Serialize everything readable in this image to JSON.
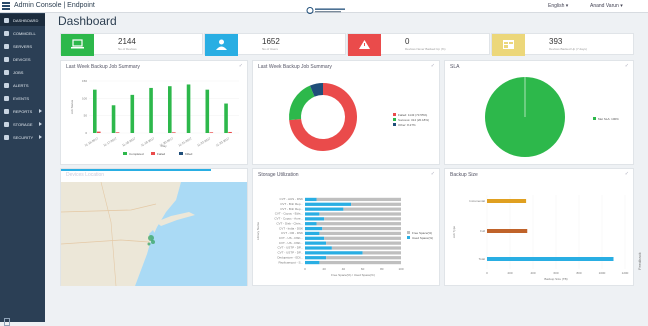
{
  "topbar": {
    "app_title": "Admin Console | Endpoint",
    "language": "English ▾",
    "user": "Anand Varun ▾"
  },
  "sidebar": {
    "items": [
      {
        "label": "DASHBOARD",
        "icon": "dashboard-icon"
      },
      {
        "label": "COMMCELL",
        "icon": "commcell-icon"
      },
      {
        "label": "SERVERS",
        "icon": "server-icon"
      },
      {
        "label": "DEVICES",
        "icon": "device-icon"
      },
      {
        "label": "JOBS",
        "icon": "jobs-icon"
      },
      {
        "label": "ALERTS",
        "icon": "alert-icon"
      },
      {
        "label": "EVENTS",
        "icon": "events-icon"
      },
      {
        "label": "REPORTS",
        "icon": "reports-icon"
      },
      {
        "label": "STORAGE",
        "icon": "storage-icon"
      },
      {
        "label": "SECURITY",
        "icon": "security-icon"
      }
    ]
  },
  "page": {
    "title": "Dashboard"
  },
  "stats": [
    {
      "value": "2144",
      "label": "No of Devices",
      "color": "#2db84b"
    },
    {
      "value": "1652",
      "label": "No of Users",
      "color": "#29aee3"
    },
    {
      "value": "0",
      "label": "Devices Never Backed Up (%)",
      "color": "#ea4b4b"
    },
    {
      "value": "393",
      "label": "Devices Backed Up (7 days)",
      "color": "#ecd77a"
    }
  ],
  "panels": {
    "jobs": {
      "title": "Last Week Backup Job Summary"
    },
    "percent": {
      "title": "Last Week Backup Job Summary"
    },
    "sla": {
      "title": "SLA"
    },
    "location": {
      "title": "Devices Location"
    },
    "storage": {
      "title": "Storage Utilization"
    },
    "backup_size": {
      "title": "Backup Size"
    }
  },
  "map": {
    "bg": "#e8e3d4"
  },
  "right_tab": "Feedback",
  "chart_data": [
    {
      "type": "bar",
      "title": "Last Week Backup Job Summary",
      "xlabel": "Day",
      "ylabel": "Job Status",
      "categories": [
        "11-16-2017",
        "11-17-2017",
        "11-18-2017",
        "11-19-2017",
        "11-20-2017",
        "11-21-2017",
        "11-22-2017",
        "11-23-2017"
      ],
      "ylim": [
        0,
        150
      ],
      "series": [
        {
          "name": "Completed",
          "values": [
            125,
            80,
            110,
            130,
            135,
            140,
            125,
            85
          ],
          "color": "#2db84b"
        },
        {
          "name": "Failed",
          "values": [
            4,
            2,
            0,
            0,
            2,
            0,
            2,
            3
          ],
          "color": "#ea4b4b"
        },
        {
          "name": "Killed",
          "values": [
            0,
            0,
            0,
            0,
            0,
            0,
            0,
            0
          ],
          "color": "#1f4e79"
        }
      ],
      "yticks": [
        "150",
        "100",
        "50",
        "0"
      ]
    },
    {
      "type": "pie",
      "title": "Last Week Backup Job Summary",
      "donut": true,
      "slices": [
        {
          "label": "Failed: 1143 (73.55%)",
          "value": 73.55,
          "color": "#ea4b4b"
        },
        {
          "label": "Success: 314 (20.18%)",
          "value": 20.18,
          "color": "#2db84b"
        },
        {
          "label": "Other: 8.27%",
          "value": 6.27,
          "color": "#1f4e79"
        }
      ]
    },
    {
      "type": "pie",
      "title": "SLA",
      "slices": [
        {
          "label": "Met SLA: 100%",
          "value": 100,
          "color": "#2db84b"
        }
      ]
    },
    {
      "type": "bar",
      "orientation": "horizontal",
      "title": "Storage Utilization",
      "xlabel": "Free Space(%) / Used Space(%)",
      "ylabel": "Library Name",
      "categories": [
        "CVT - AUS - DSK",
        "CVT - Bnlr Rep...",
        "CVT - Bnlr Rep...",
        "CVT - Copoc - Edis...",
        "CVT - Copoc - Aure...",
        "CVT - Disk - Chris...",
        "CVT - India - DSK",
        "CVT - OR - DSK",
        "CVT - US - DSK...",
        "CVT - US - DSK...",
        "CVT - USTP - DP...",
        "CVT - USTP - DP...",
        "Dedupstore - EDI...",
        "Replicaexpot - S..."
      ],
      "series": [
        {
          "name": "Free Space(%)",
          "values": [
            88,
            52,
            60,
            85,
            80,
            88,
            82,
            85,
            80,
            78,
            72,
            40,
            78,
            85
          ],
          "color": "#bfbfbf"
        },
        {
          "name": "Used Space(%)",
          "values": [
            12,
            48,
            40,
            15,
            20,
            12,
            18,
            15,
            20,
            22,
            28,
            60,
            22,
            15
          ],
          "color": "#29aee3"
        }
      ],
      "xticks": [
        "0",
        "20",
        "40",
        "60",
        "80",
        "100"
      ]
    },
    {
      "type": "bar",
      "orientation": "horizontal",
      "title": "Backup Size",
      "xlabel": "Backup Size (TB)",
      "ylabel": "Job Type",
      "categories": [
        "Incremental",
        "Full",
        "Total"
      ],
      "values": [
        340,
        350,
        1100
      ],
      "colors": [
        "#e0a020",
        "#c0632a",
        "#29aee3"
      ],
      "xticks": [
        "0",
        "200",
        "400",
        "600",
        "800",
        "1000",
        "1200"
      ]
    }
  ]
}
